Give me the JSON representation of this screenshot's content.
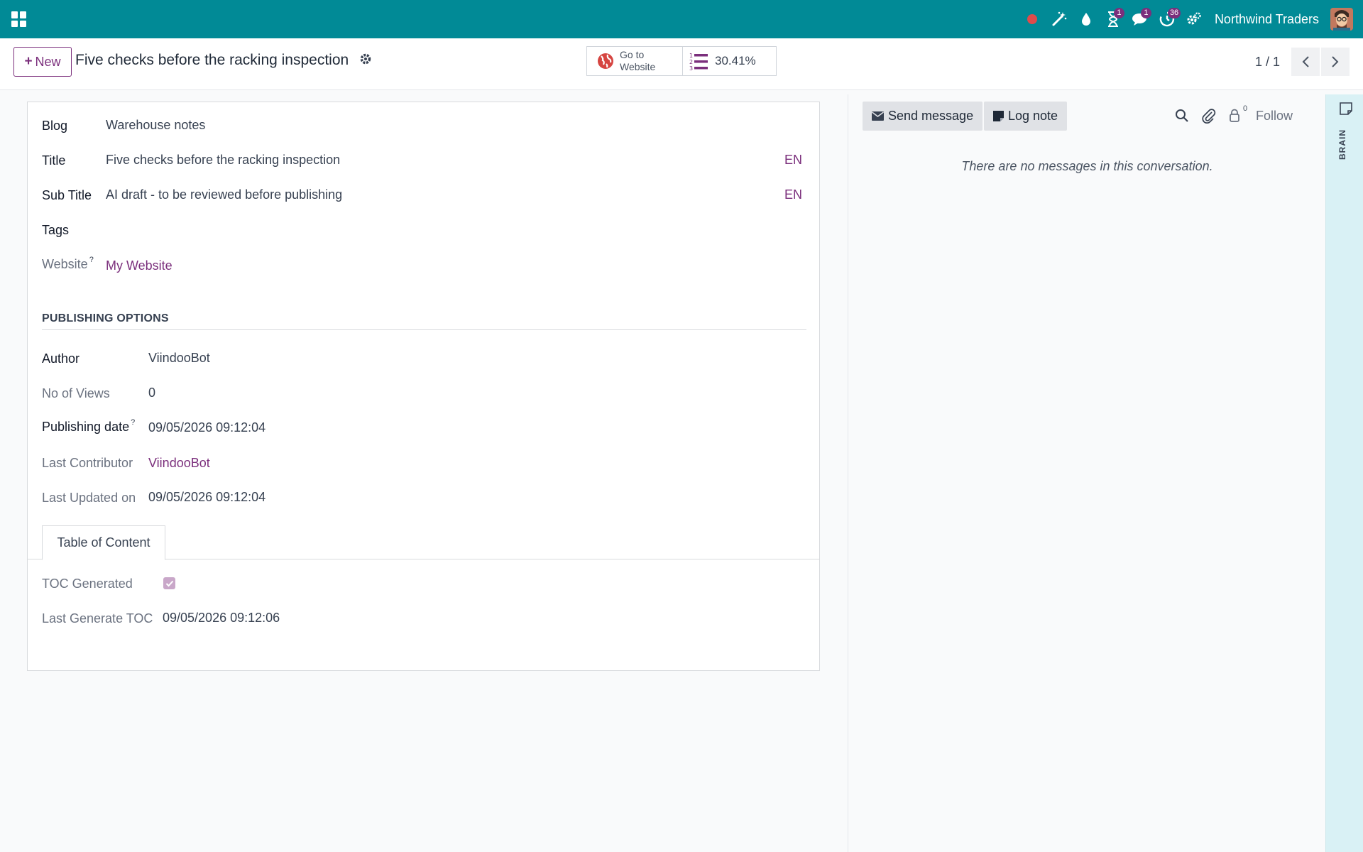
{
  "navbar": {
    "company": "Northwind Traders",
    "activity_badge": "1",
    "messages_badge": "1",
    "timer_badge": "36"
  },
  "control_panel": {
    "new_label": "New",
    "record_title": "Five checks before the racking inspection",
    "website_button": {
      "line1": "Go to",
      "line2": "Website"
    },
    "seo_value": "30.41%",
    "pager_value": "1 / 1"
  },
  "form": {
    "blog": {
      "label": "Blog",
      "value": "Warehouse notes"
    },
    "title": {
      "label": "Title",
      "value": "Five checks before the racking inspection",
      "lang": "EN"
    },
    "subtitle": {
      "label": "Sub Title",
      "value": "AI draft - to be reviewed before publishing",
      "lang": "EN"
    },
    "tags": {
      "label": "Tags"
    },
    "website": {
      "label": "Website",
      "help": "?",
      "value": "My Website"
    },
    "publishing_section": "PUBLISHING OPTIONS",
    "author": {
      "label": "Author",
      "value": "ViindooBot"
    },
    "views": {
      "label": "No of Views",
      "value": "0"
    },
    "publishing_date": {
      "label": "Publishing date",
      "help": "?",
      "value": "09/05/2026 09:12:04"
    },
    "last_contributor": {
      "label": "Last Contributor",
      "value": "ViindooBot"
    },
    "last_updated": {
      "label": "Last Updated on",
      "value": "09/05/2026 09:12:04"
    },
    "tab_label": "Table of Content",
    "toc_generated": {
      "label": "TOC Generated",
      "checked": true
    },
    "last_generate_toc": {
      "label": "Last Generate TOC",
      "value": "09/05/2026 09:12:06"
    }
  },
  "chatter": {
    "send_message": "Send message",
    "log_note": "Log note",
    "follower_count": "0",
    "follow": "Follow",
    "empty_text": "There are no messages in this conversation."
  },
  "brain": {
    "label": "BRAIN"
  },
  "colors": {
    "navbar": "#018a96",
    "brand": "#7b2f7c",
    "brain_strip": "#d9f1f5"
  },
  "icons": [
    "apps-grid-icon",
    "record-icon",
    "magic-wand-icon",
    "droplet-icon",
    "hourglass-icon",
    "chat-icon",
    "timer-icon",
    "settings-icon",
    "globe-icon",
    "list-numbered-icon",
    "gear-icon",
    "chevron-left-icon",
    "chevron-right-icon",
    "envelope-icon",
    "note-icon",
    "search-icon",
    "paperclip-icon",
    "follower-icon",
    "sticky-note-icon"
  ]
}
